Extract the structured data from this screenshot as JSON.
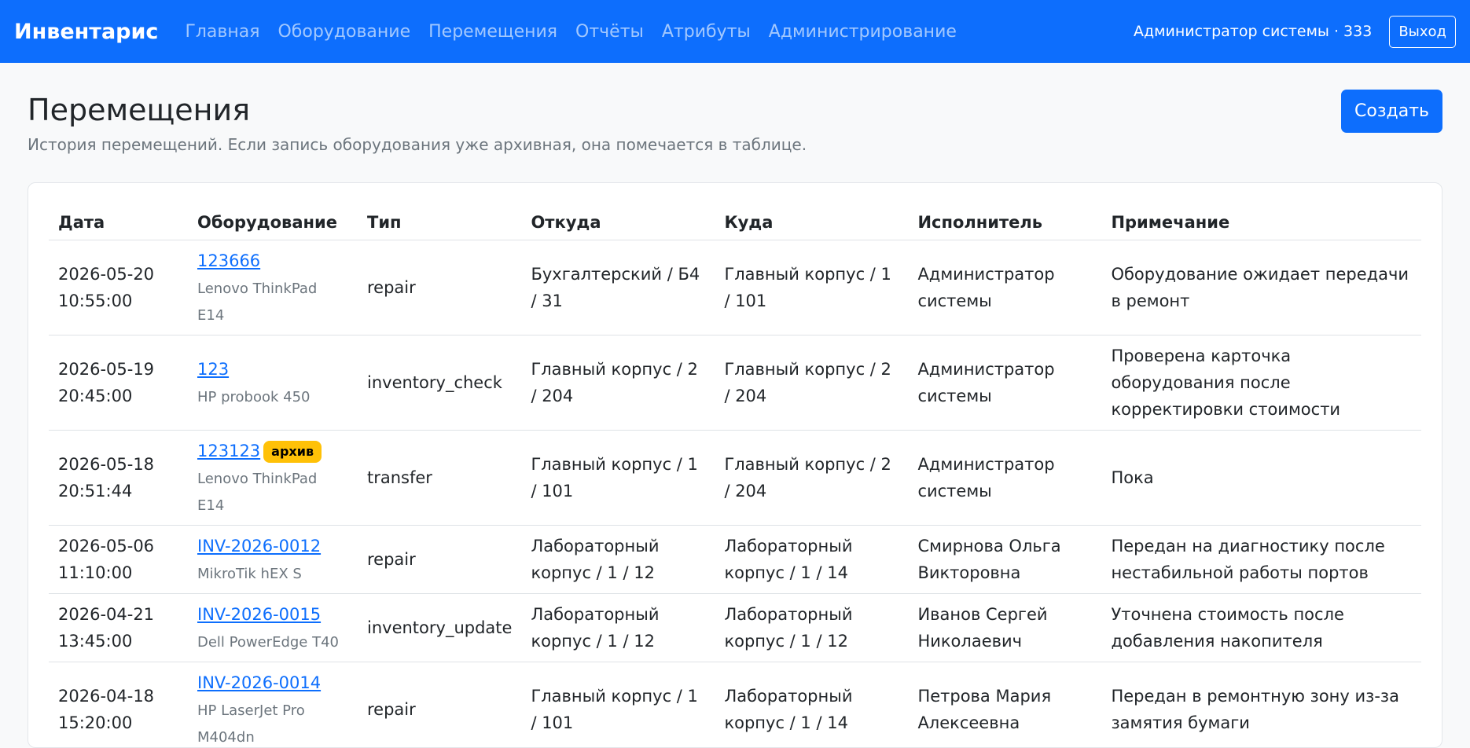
{
  "navbar": {
    "brand": "Инвентарис",
    "links": [
      "Главная",
      "Оборудование",
      "Перемещения",
      "Отчёты",
      "Атрибуты",
      "Администрирование"
    ],
    "user": "Администратор системы · 333",
    "logout_label": "Выход"
  },
  "page": {
    "title": "Перемещения",
    "subtitle": "История перемещений. Если запись оборудования уже архивная, она помечается в таблице.",
    "create_label": "Создать"
  },
  "table": {
    "headers": [
      "Дата",
      "Оборудование",
      "Тип",
      "Откуда",
      "Куда",
      "Исполнитель",
      "Примечание"
    ],
    "rows": [
      {
        "date": "2026-05-20 10:55:00",
        "code": "123666",
        "model": "Lenovo ThinkPad E14",
        "badge": "",
        "type": "repair",
        "from": "Бухгалтерский / Б4 / 31",
        "to": "Главный корпус / 1 / 101",
        "executor": "Администратор системы",
        "note": "Оборудование ожидает передачи в ремонт"
      },
      {
        "date": "2026-05-19 20:45:00",
        "code": "123",
        "model": "HP probook 450",
        "badge": "",
        "type": "inventory_check",
        "from": "Главный корпус / 2 / 204",
        "to": "Главный корпус / 2 / 204",
        "executor": "Администратор системы",
        "note": "Проверена карточка оборудования после корректировки стоимости"
      },
      {
        "date": "2026-05-18 20:51:44",
        "code": "123123",
        "model": "Lenovo ThinkPad E14",
        "badge": "архив",
        "type": "transfer",
        "from": "Главный корпус / 1 / 101",
        "to": "Главный корпус / 2 / 204",
        "executor": "Администратор системы",
        "note": "Пока"
      },
      {
        "date": "2026-05-06 11:10:00",
        "code": "INV-2026-0012",
        "model": "MikroTik hEX S",
        "badge": "",
        "type": "repair",
        "from": "Лабораторный корпус / 1 / 12",
        "to": "Лабораторный корпус / 1 / 14",
        "executor": "Смирнова Ольга Викторовна",
        "note": "Передан на диагностику после нестабильной работы портов"
      },
      {
        "date": "2026-04-21 13:45:00",
        "code": "INV-2026-0015",
        "model": "Dell PowerEdge T40",
        "badge": "",
        "type": "inventory_update",
        "from": "Лабораторный корпус / 1 / 12",
        "to": "Лабораторный корпус / 1 / 12",
        "executor": "Иванов Сергей Николаевич",
        "note": "Уточнена стоимость после добавления накопителя"
      },
      {
        "date": "2026-04-18 15:20:00",
        "code": "INV-2026-0014",
        "model": "HP LaserJet Pro M404dn",
        "badge": "",
        "type": "repair",
        "from": "Главный корпус / 1 / 101",
        "to": "Лабораторный корпус / 1 / 14",
        "executor": "Петрова Мария Алексеевна",
        "note": "Передан в ремонтную зону из-за замятия бумаги"
      }
    ]
  }
}
